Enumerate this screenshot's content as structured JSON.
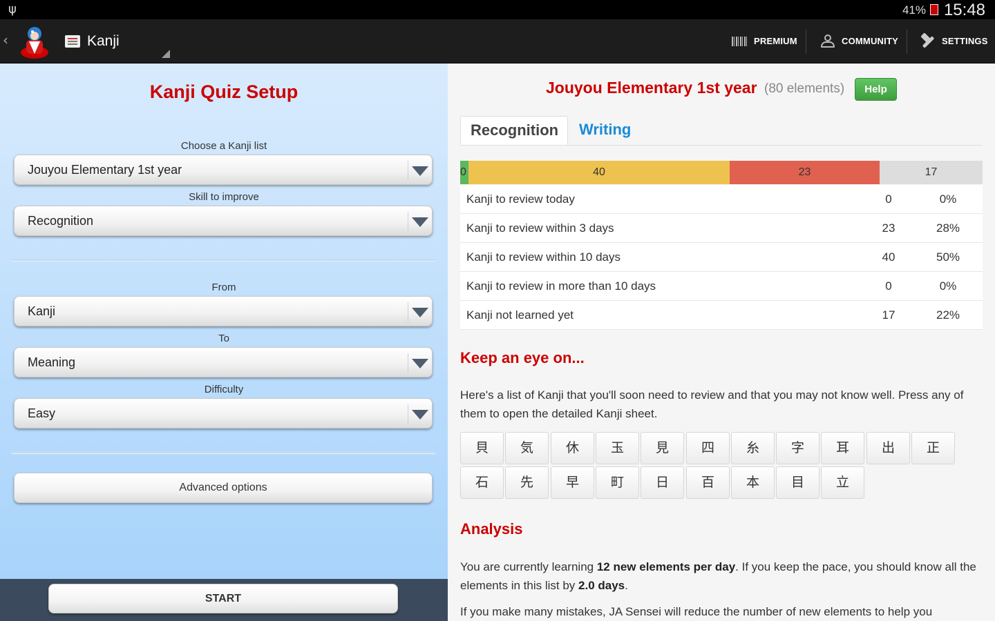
{
  "status_bar": {
    "battery": "41%",
    "time": "15:48"
  },
  "action_bar": {
    "title": "Kanji",
    "actions": {
      "premium": "PREMIUM",
      "community": "COMMUNITY",
      "settings": "SETTINGS"
    }
  },
  "setup": {
    "title": "Kanji Quiz Setup",
    "list_label": "Choose a Kanji list",
    "list_value": "Jouyou Elementary 1st year",
    "skill_label": "Skill to improve",
    "skill_value": "Recognition",
    "from_label": "From",
    "from_value": "Kanji",
    "to_label": "To",
    "to_value": "Meaning",
    "difficulty_label": "Difficulty",
    "difficulty_value": "Easy",
    "advanced_label": "Advanced options",
    "start_label": "START"
  },
  "summary": {
    "list_name": "Jouyou Elementary 1st year",
    "element_count": "(80 elements)",
    "help_label": "Help",
    "tabs": [
      "Recognition",
      "Writing"
    ],
    "progress": [
      {
        "label": "0",
        "value": 0,
        "color": "#5cb85c"
      },
      {
        "label": "40",
        "value": 40,
        "color": "#eec24e"
      },
      {
        "label": "23",
        "value": 23,
        "color": "#e0614f"
      },
      {
        "label": "17",
        "value": 17,
        "color": "#dddddd"
      }
    ],
    "stats": [
      {
        "label": "Kanji to review today",
        "count": "0",
        "percent": "0%"
      },
      {
        "label": "Kanji to review within 3 days",
        "count": "23",
        "percent": "28%"
      },
      {
        "label": "Kanji to review within 10 days",
        "count": "40",
        "percent": "50%"
      },
      {
        "label": "Kanji to review in more than 10 days",
        "count": "0",
        "percent": "0%"
      },
      {
        "label": "Kanji not learned yet",
        "count": "17",
        "percent": "22%"
      }
    ]
  },
  "keep_eye": {
    "heading": "Keep an eye on...",
    "description": "Here's a list of Kanji that you'll soon need to review and that you may not know well. Press any of them to open the detailed Kanji sheet.",
    "kanji": [
      "貝",
      "気",
      "休",
      "玉",
      "見",
      "四",
      "糸",
      "字",
      "耳",
      "出",
      "正",
      "石",
      "先",
      "早",
      "町",
      "日",
      "百",
      "本",
      "目",
      "立"
    ]
  },
  "analysis": {
    "heading": "Analysis",
    "p1_before": "You are currently learning ",
    "p1_bold1": "12 new elements per day",
    "p1_middle": ". If you keep the pace, you should know all the elements in this list by ",
    "p1_bold2": "2.0 days",
    "p1_after": ".",
    "p2": "If you make many mistakes, JA Sensei will reduce the number of new elements to help you"
  }
}
